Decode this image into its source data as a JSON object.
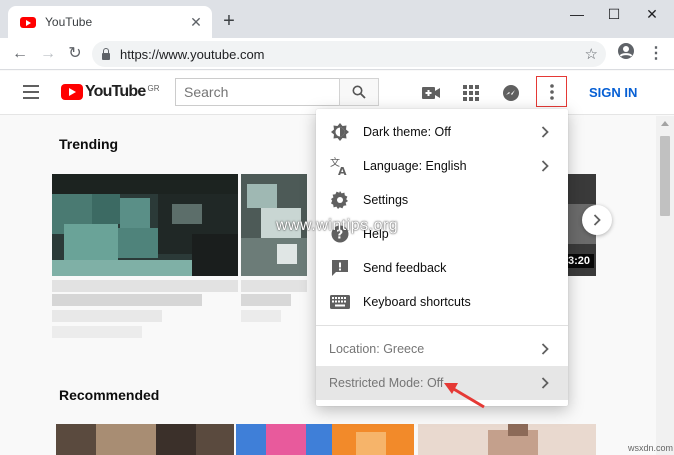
{
  "browser": {
    "tab_title": "YouTube",
    "tab_close": "✕",
    "new_tab": "+",
    "minimize": "—",
    "maximize": "☐",
    "close": "✕",
    "url": "https://www.youtube.com",
    "back": "←",
    "forward": "→",
    "reload": "↻"
  },
  "header": {
    "logo_text": "YouTube",
    "logo_region": "GR",
    "search_placeholder": "Search",
    "sign_in": "SIGN IN"
  },
  "content": {
    "trending_title": "Trending",
    "recommended_title": "Recommended",
    "duration": "3:20",
    "next_arrow": "›"
  },
  "menu": {
    "items": [
      {
        "label": "Dark theme: Off",
        "icon": "dark-theme-icon",
        "chevron": true
      },
      {
        "label": "Language: English",
        "icon": "translate-icon",
        "chevron": true
      },
      {
        "label": "Settings",
        "icon": "gear-icon",
        "chevron": false
      },
      {
        "label": "Help",
        "icon": "help-icon",
        "chevron": false
      },
      {
        "label": "Send feedback",
        "icon": "feedback-icon",
        "chevron": false
      },
      {
        "label": "Keyboard shortcuts",
        "icon": "keyboard-icon",
        "chevron": false
      },
      {
        "label": "Location: Greece",
        "icon": "",
        "chevron": true
      },
      {
        "label": "Restricted Mode: Off",
        "icon": "",
        "chevron": true
      }
    ]
  },
  "watermark": "www.wintips.org",
  "corner_mark": "wsxdn.com",
  "colors": {
    "youtube_red": "#ff0000",
    "signin_blue": "#065fd4",
    "highlight_box": "#e53935",
    "annotation_arrow": "#e53935"
  }
}
